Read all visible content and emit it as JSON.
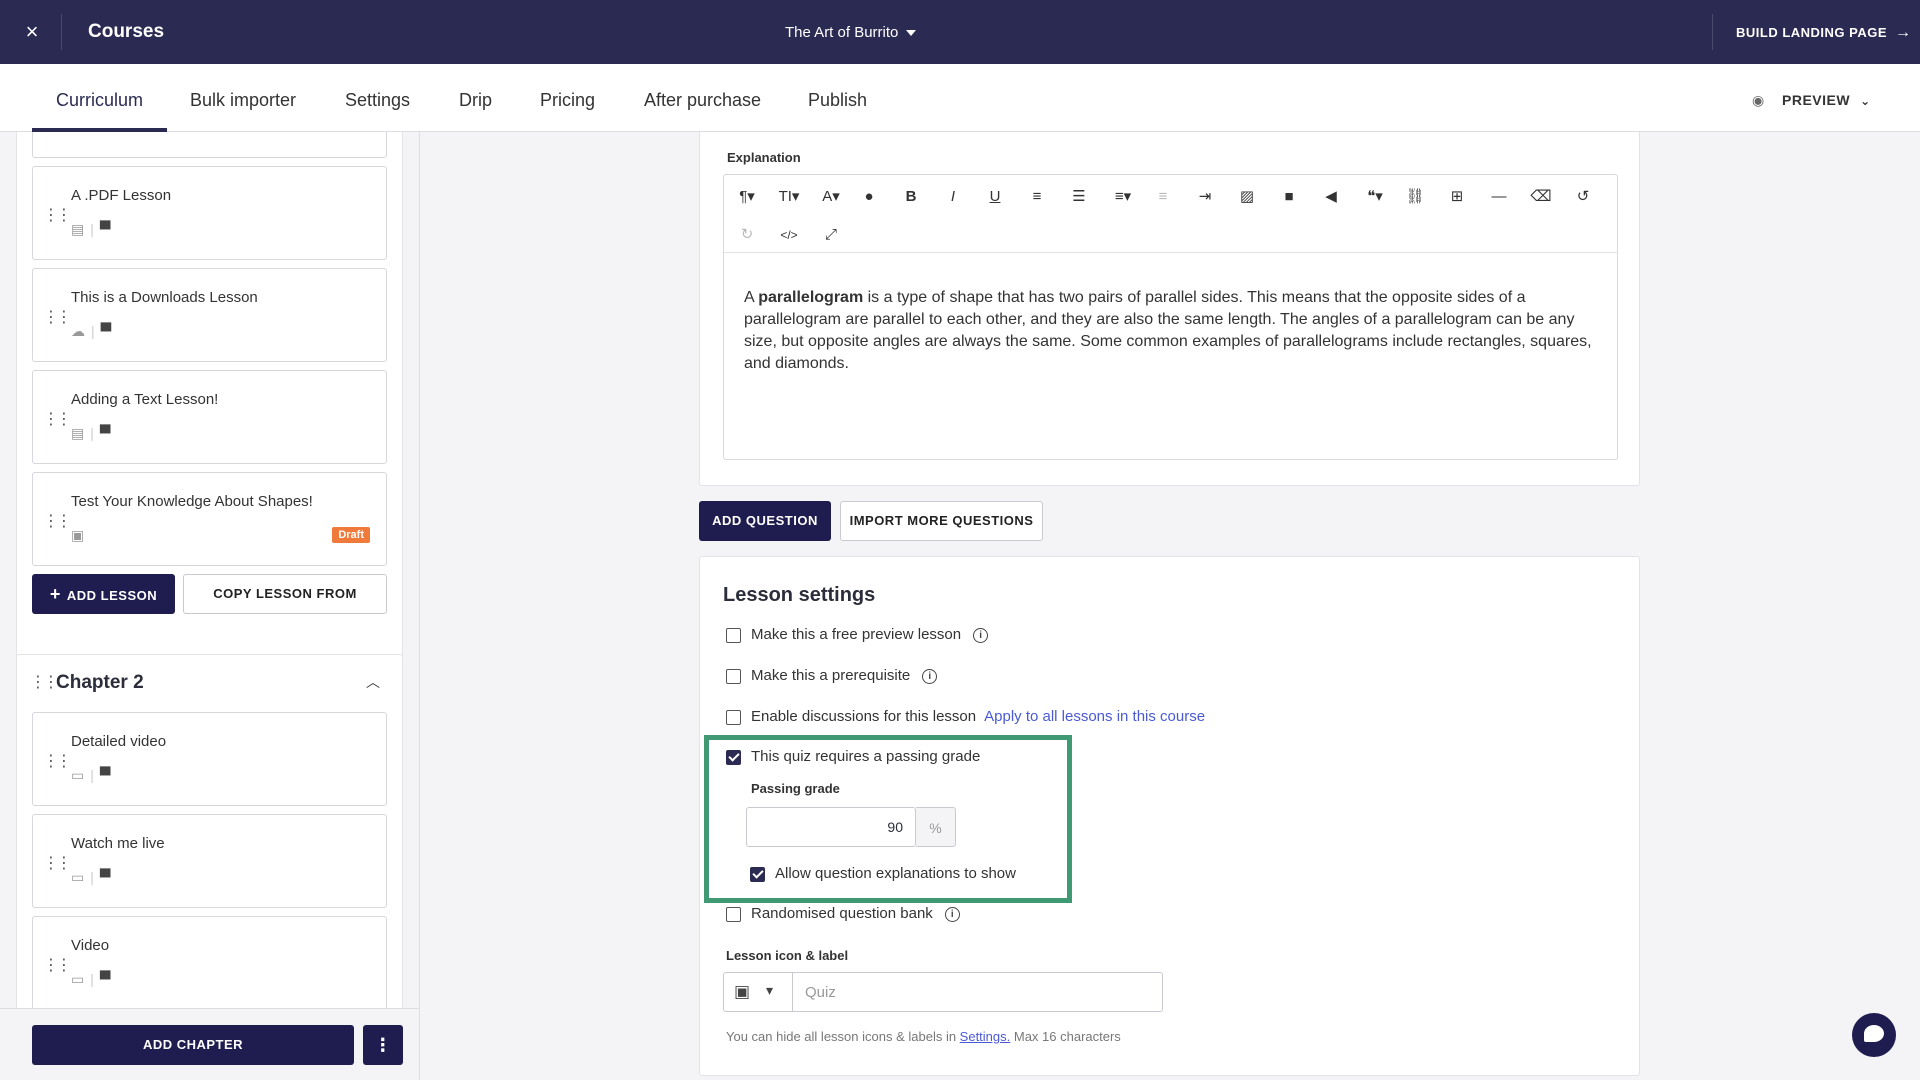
{
  "topbar": {
    "close_icon": "×",
    "title": "Courses",
    "course_name": "The Art of Burrito",
    "landing_label": "BUILD LANDING PAGE",
    "landing_arrow": "→"
  },
  "tabs": [
    {
      "label": "Curriculum"
    },
    {
      "label": "Bulk importer"
    },
    {
      "label": "Settings"
    },
    {
      "label": "Drip"
    },
    {
      "label": "Pricing"
    },
    {
      "label": "After purchase"
    },
    {
      "label": "Publish"
    }
  ],
  "preview": {
    "label": "PREVIEW",
    "eye": "◉",
    "chevron": "⌄"
  },
  "sidebar": {
    "chapter1_lessons": [
      {
        "name": "A .PDF Lesson",
        "icon": "▤",
        "chat": "▀"
      },
      {
        "name": "This is a Downloads Lesson",
        "icon": "☁",
        "chat": "▀"
      },
      {
        "name": "Adding a Text Lesson!",
        "icon": "▤",
        "chat": "▀"
      },
      {
        "name": "Test Your Knowledge About Shapes!",
        "icon": "▣",
        "badge": "Draft"
      }
    ],
    "add_lesson": "ADD LESSON",
    "add_lesson_plus": "+",
    "copy_lesson": "COPY LESSON FROM",
    "chapter2": {
      "title": "Chapter 2",
      "chevron": "︿",
      "lessons": [
        {
          "name": "Detailed video",
          "icon": "▭",
          "chat": "▀"
        },
        {
          "name": "Watch me live",
          "icon": "▭",
          "chat": "▀"
        },
        {
          "name": "Video",
          "icon": "▭",
          "chat": "▀"
        }
      ]
    },
    "add_chapter": "ADD CHAPTER",
    "more": "⋮",
    "grip": "⋮⋮"
  },
  "editor": {
    "label": "Explanation",
    "toolbar": [
      "¶▾",
      "TI▾",
      "A▾",
      "●",
      "B",
      "I",
      "U",
      "≡",
      "☰",
      "≡▾",
      "≡",
      "⇥",
      "▨",
      "■",
      "◀",
      "❝▾",
      "⛓",
      "⊞",
      "—",
      "⌫",
      "↺",
      "↻",
      "</>",
      "⤢"
    ],
    "text_bold": "parallelogram",
    "text_before": "A ",
    "text_after": " is a type of shape that has two pairs of parallel sides. This means that the opposite sides of a parallelogram are parallel to each other, and they are also the same length. The angles of a parallelogram can be any size, but opposite angles are always the same. Some common examples of parallelograms include rectangles, squares, and diamonds."
  },
  "question_buttons": {
    "add": "ADD QUESTION",
    "import": "IMPORT MORE QUESTIONS"
  },
  "settings": {
    "title": "Lesson settings",
    "free_preview": {
      "label": "Make this a free preview lesson",
      "checked": false
    },
    "prerequisite": {
      "label": "Make this a prerequisite",
      "checked": false
    },
    "discussions": {
      "label": "Enable discussions for this lesson",
      "checked": false,
      "link": "Apply to all lessons in this course"
    },
    "passing_grade_req": {
      "label": "This quiz requires a passing grade",
      "checked": true
    },
    "passing_grade_label": "Passing grade",
    "passing_grade_value": "90",
    "passing_grade_suffix": "%",
    "allow_explanations": {
      "label": "Allow question explanations to show",
      "checked": true
    },
    "randomised": {
      "label": "Randomised question bank",
      "checked": false
    },
    "info": "i",
    "icon_label_title": "Lesson icon & label",
    "icon_glyph": "▣",
    "icon_caret": "▾",
    "label_placeholder": "Quiz",
    "help_before": "You can hide all lesson icons & labels in ",
    "help_link": "Settings.",
    "help_after": " Max 16 characters"
  },
  "colors": {
    "primary": "#1f1d4f",
    "topbar": "#2b2a53",
    "highlight": "#3f9a73",
    "draft": "#f07a3a",
    "link": "#4a5ad6"
  }
}
